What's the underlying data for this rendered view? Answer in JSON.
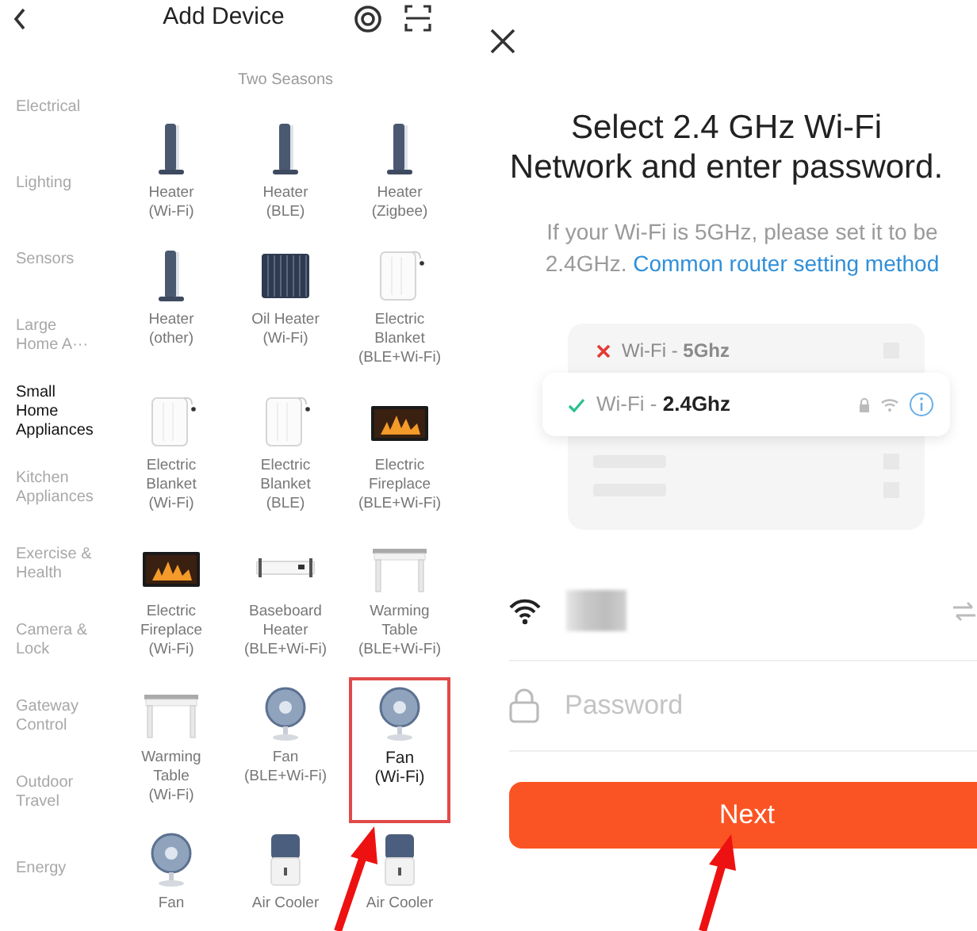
{
  "device_list": {
    "title": "Add Device",
    "section_title": "Two Seasons",
    "categories": [
      {
        "label": "Electrical",
        "selected": false
      },
      {
        "label": "Lighting",
        "selected": false
      },
      {
        "label": "Sensors",
        "selected": false
      },
      {
        "label": "Large\nHome A···",
        "selected": false
      },
      {
        "label": "Small\nHome\nAppliances",
        "selected": true
      },
      {
        "label": "Kitchen\nAppliances",
        "selected": false
      },
      {
        "label": "Exercise &\nHealth",
        "selected": false
      },
      {
        "label": "Camera &\nLock",
        "selected": false
      },
      {
        "label": "Gateway\nControl",
        "selected": false
      },
      {
        "label": "Outdoor\nTravel",
        "selected": false
      },
      {
        "label": "Energy",
        "selected": false
      }
    ],
    "devices": [
      {
        "label": "Heater\n(Wi-Fi)",
        "kind": "tower",
        "selected": false
      },
      {
        "label": "Heater\n(BLE)",
        "kind": "tower",
        "selected": false
      },
      {
        "label": "Heater\n(Zigbee)",
        "kind": "tower",
        "selected": false
      },
      {
        "label": "Heater\n(other)",
        "kind": "tower",
        "selected": false
      },
      {
        "label": "Oil Heater\n(Wi-Fi)",
        "kind": "oil",
        "selected": false
      },
      {
        "label": "Electric\nBlanket\n(BLE+Wi-Fi)",
        "kind": "panel",
        "selected": false
      },
      {
        "label": "Electric\nBlanket\n(Wi-Fi)",
        "kind": "panel",
        "selected": false
      },
      {
        "label": "Electric\nBlanket\n(BLE)",
        "kind": "panel",
        "selected": false
      },
      {
        "label": "Electric\nFireplace\n(BLE+Wi-Fi)",
        "kind": "fireplace",
        "selected": false
      },
      {
        "label": "Electric\nFireplace\n(Wi-Fi)",
        "kind": "fireplace",
        "selected": false
      },
      {
        "label": "Baseboard\nHeater\n(BLE+Wi-Fi)",
        "kind": "baseboard",
        "selected": false
      },
      {
        "label": "Warming\nTable\n(BLE+Wi-Fi)",
        "kind": "table",
        "selected": false
      },
      {
        "label": "Warming\nTable\n(Wi-Fi)",
        "kind": "table",
        "selected": false
      },
      {
        "label": "Fan\n(BLE+Wi-Fi)",
        "kind": "fan",
        "selected": false
      },
      {
        "label": "Fan\n(Wi-Fi)",
        "kind": "fan",
        "selected": true
      },
      {
        "label": "Fan",
        "kind": "fan",
        "selected": false
      },
      {
        "label": "Air Cooler",
        "kind": "cooler",
        "selected": false
      },
      {
        "label": "Air Cooler",
        "kind": "cooler",
        "selected": false
      }
    ]
  },
  "wifi_setup": {
    "title_lines": [
      "Select 2.4 GHz Wi-Fi",
      "Network and enter password."
    ],
    "hint": "If your Wi-Fi is 5GHz, please set it to be 2.4GHz.",
    "link": "Common router setting method",
    "networks": [
      {
        "label": "Wi-Fi - **5Ghz**",
        "supported": false
      },
      {
        "label": "Wi-Fi - **2.4Ghz**",
        "supported": true
      }
    ],
    "password": {
      "placeholder": "Password"
    },
    "next_button": "Next"
  }
}
